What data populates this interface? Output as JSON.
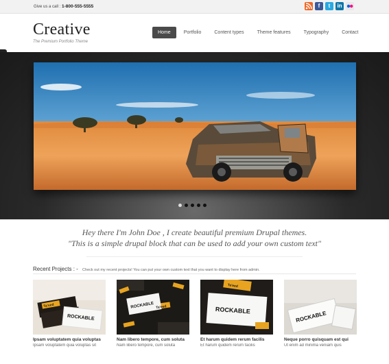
{
  "topbar": {
    "call_label": "Give us a call :",
    "phone": "1-800-555-5555"
  },
  "social": [
    {
      "name": "rss-icon",
      "glyph": "",
      "color": "#f26522"
    },
    {
      "name": "facebook-icon",
      "glyph": "f",
      "color": "#3b5998"
    },
    {
      "name": "twitter-icon",
      "glyph": "t",
      "color": "#29a9e1"
    },
    {
      "name": "linkedin-icon",
      "glyph": "in",
      "color": "#0e76a8"
    },
    {
      "name": "flickr-icon",
      "glyph": "",
      "color": "#e8e8e8"
    }
  ],
  "brand": {
    "logo": "Creative",
    "tagline": "The Premium Portfolio Theme"
  },
  "nav": [
    {
      "label": "Home",
      "active": true
    },
    {
      "label": "Portfolio"
    },
    {
      "label": "Content types"
    },
    {
      "label": "Theme features"
    },
    {
      "label": "Typography"
    },
    {
      "label": "Contact"
    }
  ],
  "slider": {
    "slides": 5,
    "active": 1
  },
  "intro": {
    "line1": "Hey there I'm John Doe , I create beautiful premium Drupal themes.",
    "line2": "\"This is a simple drupal block that can be used to add your own custom text\""
  },
  "recent": {
    "title": "Recent Projects : -",
    "desc": "Check out my recent projects! You can put your own custom text that you want to display here from admin."
  },
  "projects": [
    {
      "title": "Ipsam voluptatem quia voluptas",
      "subtitle": "Ipsam voluptatem quia voluptas sit"
    },
    {
      "title": "Nam libero tempore, cum soluta",
      "subtitle": "Nam libero tempore, cum soluta"
    },
    {
      "title": "Et harum quidem rerum facilis",
      "subtitle": "Et harum quidem rerum facilis"
    },
    {
      "title": "Neque porro quisquam est qui",
      "subtitle": "Ut enim ad minima veniam quis"
    }
  ],
  "card_text": {
    "brand": "ROCKABLE",
    "tagline": "Ta'eed"
  }
}
